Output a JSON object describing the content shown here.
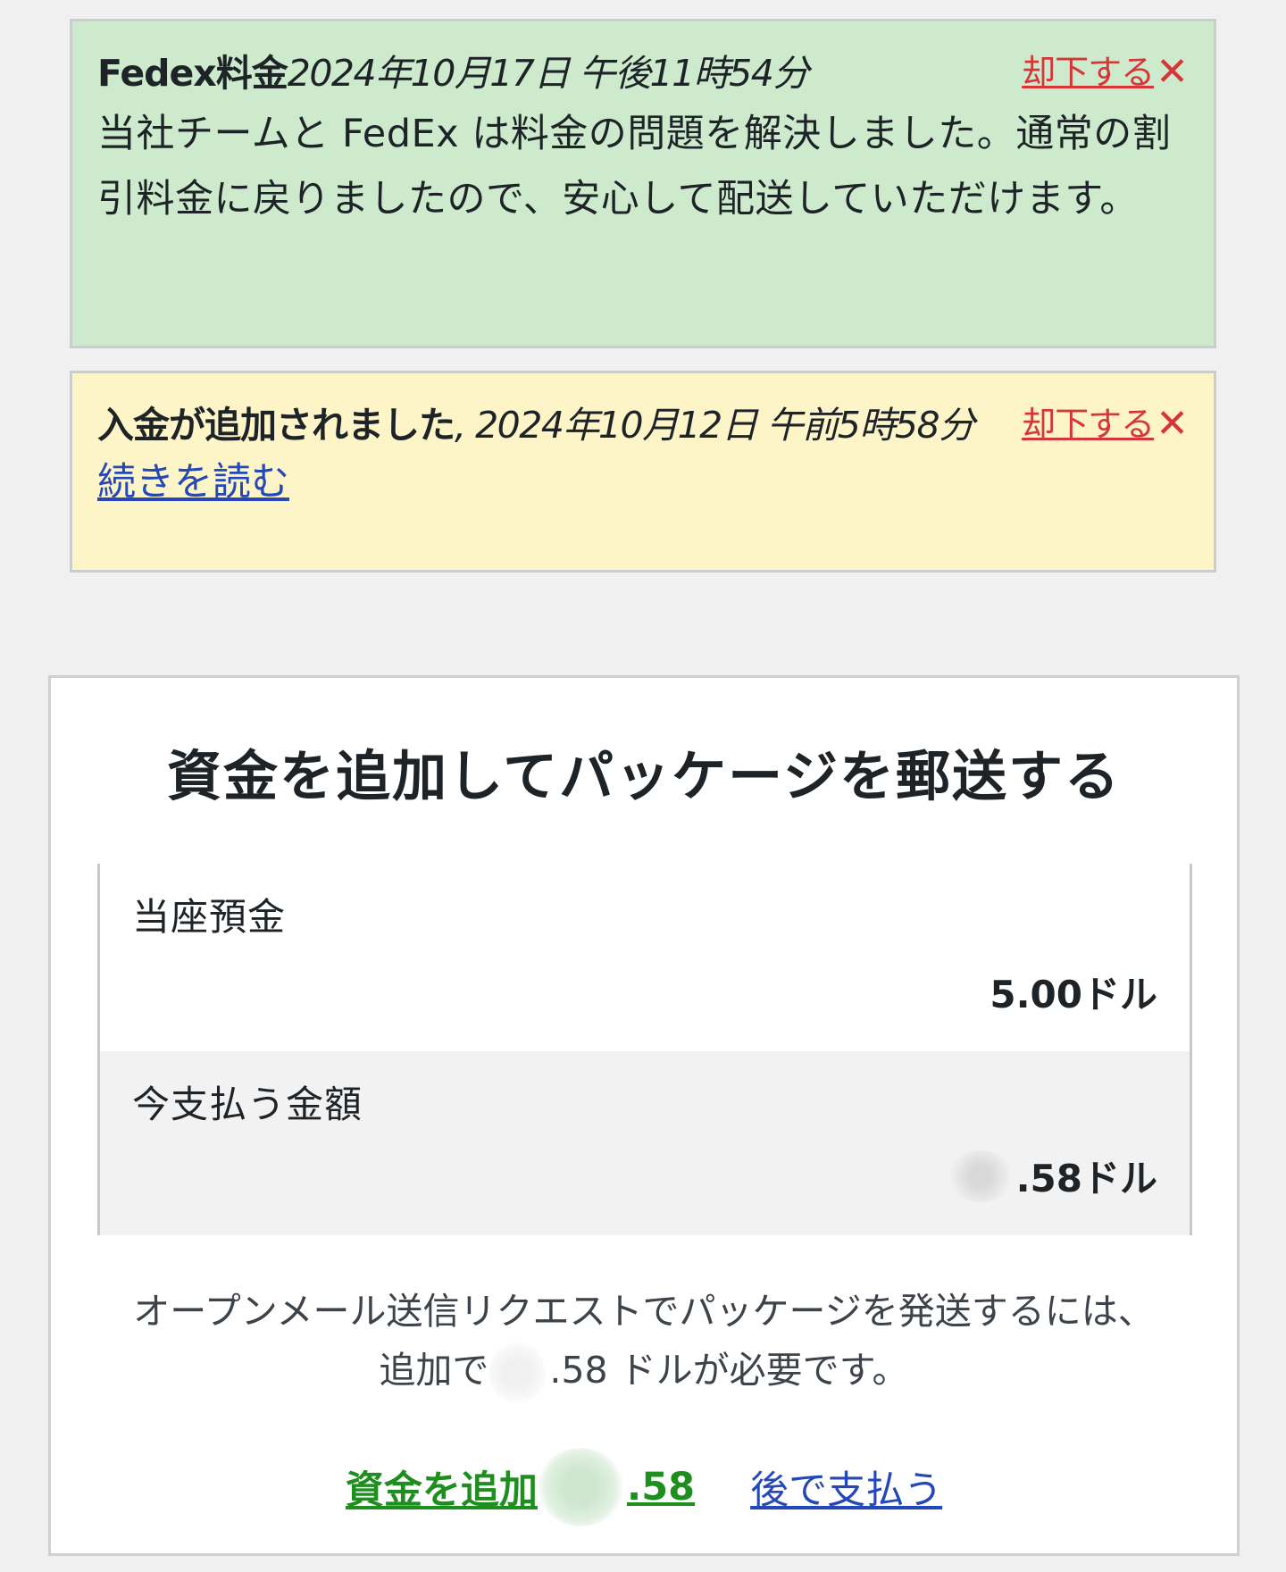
{
  "notices": [
    {
      "title": "Fedex料金",
      "date": "2024年10月17日 午後11時54分",
      "dismiss_label": "却下する",
      "dismiss_icon": "close-icon",
      "body": "当社チームと FedEx は料金の問題を解決しました。通常の割引料金に戻りましたので、安心して配送していただけます。",
      "background": "#cdeacd"
    },
    {
      "title": "入金が追加されました",
      "date": ", 2024年10月12日 午前5時58分",
      "dismiss_label": "却下する",
      "dismiss_icon": "close-icon",
      "read_more": "続きを読む",
      "background": "#fdf4c8"
    }
  ],
  "panel": {
    "title": "資金を追加してパッケージを郵送する",
    "balance_label": "当座預金",
    "balance_value": "5.00ドル",
    "due_label": "今支払う金額",
    "due_value": ".58ドル",
    "message_line1": "オープンメール送信リクエストでパッケージを発送するには、",
    "message_prefix": "追加で",
    "message_suffix": ".58 ドルが必要です。",
    "add_funds_label": "資金を追加",
    "add_funds_amount": ".58",
    "pay_later_label": "後で支払う"
  },
  "colors": {
    "dismiss": "#d63638",
    "link": "#2448b8",
    "add_funds": "#1e8f1e"
  }
}
